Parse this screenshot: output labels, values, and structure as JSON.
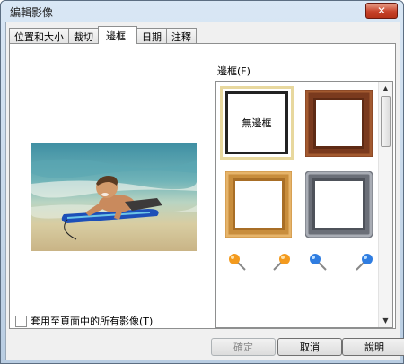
{
  "window": {
    "title": "編輯影像",
    "close_glyph": "✕"
  },
  "tabs": [
    {
      "label": "位置和大小",
      "active": false
    },
    {
      "label": "裁切",
      "active": false
    },
    {
      "label": "邊框",
      "active": true
    },
    {
      "label": "日期",
      "active": false
    },
    {
      "label": "注釋",
      "active": false
    }
  ],
  "frames": {
    "label": "邊框(F)",
    "none_label": "無邊框",
    "styles": [
      "none",
      "dark-wood",
      "light-wood",
      "silver-metal"
    ],
    "pins": [
      "orange",
      "orange",
      "blue",
      "blue"
    ]
  },
  "preview": {
    "subject": "boy-on-bodyboard-beach-photo"
  },
  "apply_all": {
    "label": "套用至頁面中的所有影像(T)",
    "checked": false
  },
  "buttons": {
    "ok": "確定",
    "cancel": "取消",
    "help": "說明"
  },
  "colors": {
    "selection": "#e8d89e",
    "close": "#c7422a",
    "orange_pin": "#f39a1e",
    "blue_pin": "#2f7de1"
  }
}
